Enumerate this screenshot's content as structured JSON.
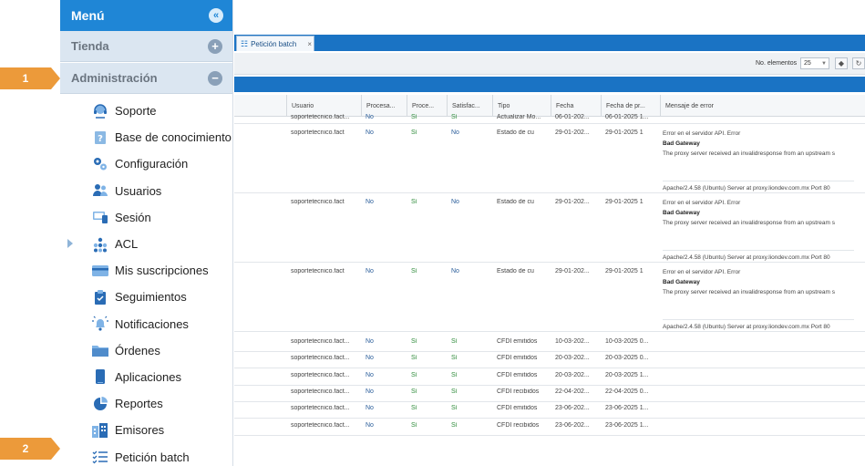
{
  "callouts": [
    "1",
    "2"
  ],
  "sidebar": {
    "menu_title": "Menú",
    "tienda": "Tienda",
    "administracion": "Administración",
    "items": [
      {
        "label": "Soporte",
        "icon": "headset-icon"
      },
      {
        "label": "Base de conocimiento",
        "icon": "help-book-icon"
      },
      {
        "label": "Configuración",
        "icon": "gears-icon"
      },
      {
        "label": "Usuarios",
        "icon": "users-icon"
      },
      {
        "label": "Sesión",
        "icon": "devices-icon"
      },
      {
        "label": "ACL",
        "icon": "acl-dots-icon"
      },
      {
        "label": "Mis suscripciones",
        "icon": "card-icon"
      },
      {
        "label": "Seguimientos",
        "icon": "clipboard-icon"
      },
      {
        "label": "Notificaciones",
        "icon": "bell-icon"
      },
      {
        "label": "Órdenes",
        "icon": "folder-icon"
      },
      {
        "label": "Aplicaciones",
        "icon": "phone-icon"
      },
      {
        "label": "Reportes",
        "icon": "pie-chart-icon"
      },
      {
        "label": "Emisores",
        "icon": "buildings-icon"
      },
      {
        "label": "Petición batch",
        "icon": "checklist-icon"
      }
    ]
  },
  "tab": {
    "label": "Petición batch",
    "close": "×"
  },
  "toolbar": {
    "label": "No. elementos",
    "page_size": "25"
  },
  "grid": {
    "headers": [
      "Usuario",
      "Procesa...",
      "Proce...",
      "Satisfac...",
      "Tipo",
      "Fecha",
      "Fecha de pr...",
      "Mensaje de error"
    ],
    "partial_row": [
      "soportetecnico.fact...",
      "No",
      "Sí",
      "Sí",
      "Actualizar Mo...",
      "06-01-202...",
      "06-01-2025 1...",
      ""
    ],
    "error_rows": [
      {
        "cells": [
          "soportetecnico.fact",
          "No",
          "Sí",
          "No",
          "Estado de cu",
          "29-01-202...",
          "29-01-2025 1"
        ],
        "err1": "Error en el servidor API. Error",
        "err2": "Bad Gateway",
        "err3": "The proxy server received an invalidresponse from an upstream s",
        "err4": "Apache/2.4.58 (Ubuntu) Server at proxy.liondev.com.mx Port 80"
      },
      {
        "cells": [
          "soportetecnico.fact",
          "No",
          "Sí",
          "No",
          "Estado de cu",
          "29-01-202...",
          "29-01-2025 1"
        ],
        "err1": "Error en el servidor API. Error",
        "err2": "Bad Gateway",
        "err3": "The proxy server received an invalidresponse from an upstream s",
        "err4": "Apache/2.4.58 (Ubuntu) Server at proxy.liondev.com.mx Port 80"
      },
      {
        "cells": [
          "soportetecnico.fact",
          "No",
          "Sí",
          "No",
          "Estado de cu",
          "29-01-202...",
          "29-01-2025 1"
        ],
        "err1": "Error en el servidor API. Error",
        "err2": "Bad Gateway",
        "err3": "The proxy server received an invalidresponse from an upstream s",
        "err4": "Apache/2.4.58 (Ubuntu) Server at proxy.liondev.com.mx Port 80"
      }
    ],
    "rows": [
      [
        "soportetecnico.fact...",
        "No",
        "Sí",
        "Sí",
        "CFDI emitidos",
        "10-03-202...",
        "10-03-2025 0..."
      ],
      [
        "soportetecnico.fact...",
        "No",
        "Sí",
        "Sí",
        "CFDI emitidos",
        "20-03-202...",
        "20-03-2025 0..."
      ],
      [
        "soportetecnico.fact...",
        "No",
        "Sí",
        "Sí",
        "CFDI emitidos",
        "20-03-202...",
        "20-03-2025 1..."
      ],
      [
        "soportetecnico.fact...",
        "No",
        "Sí",
        "Sí",
        "CFDI recibidos",
        "22-04-202...",
        "22-04-2025 0..."
      ],
      [
        "soportetecnico.fact...",
        "No",
        "Sí",
        "Sí",
        "CFDI emitidos",
        "23-06-202...",
        "23-06-2025 1..."
      ],
      [
        "soportetecnico.fact...",
        "No",
        "Sí",
        "Sí",
        "CFDI recibidos",
        "23-06-202...",
        "23-06-2025 1..."
      ]
    ]
  },
  "colors": {
    "primary": "#1f86d6",
    "tabbar": "#1a73c4",
    "callout": "#ec9a3a",
    "section": "#dbe6f1",
    "yes_green": "#2e8b3a",
    "no_blue": "#2a5d9a"
  }
}
